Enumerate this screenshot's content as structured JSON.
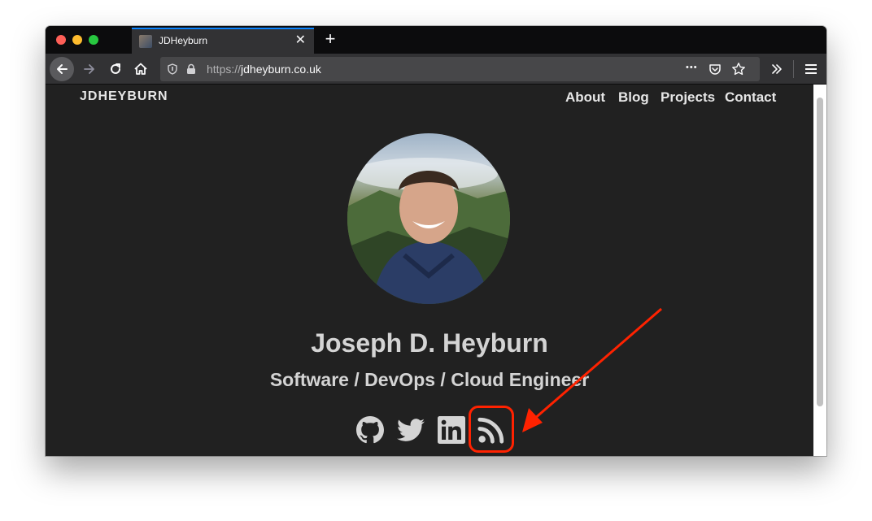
{
  "browser": {
    "tab_title": "JDHeyburn",
    "tab_close": "✕",
    "new_tab": "+",
    "url_protocol": "https://",
    "url_host": "jdheyburn.co.uk",
    "menu_dots": "•••"
  },
  "site": {
    "brand": "JDHEYBURN",
    "nav": [
      "About",
      "Blog",
      "Projects",
      "Contact"
    ],
    "name": "Joseph D. Heyburn",
    "subtitle": "Software / DevOps / Cloud Engineer"
  },
  "social_icons": [
    "github-icon",
    "twitter-icon",
    "linkedin-icon",
    "rss-icon"
  ],
  "colors": {
    "page_background": "#212121",
    "text": "#d4d4d4",
    "annotation": "#ff2200"
  }
}
